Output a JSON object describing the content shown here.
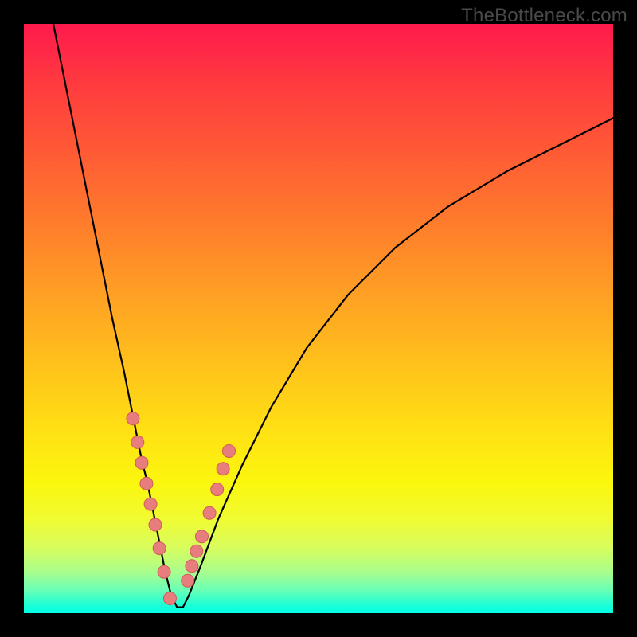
{
  "watermark": {
    "text": "TheBottleneck.com"
  },
  "colors": {
    "frame_bg": "#000000",
    "curve_stroke": "#000000",
    "marker_fill": "#e77d7d",
    "marker_stroke": "#d05a5a"
  },
  "chart_data": {
    "type": "line",
    "title": "",
    "xlabel": "",
    "ylabel": "",
    "xlim": [
      0,
      100
    ],
    "ylim": [
      0,
      100
    ],
    "grid": false,
    "legend": false,
    "series": [
      {
        "name": "bottleneck-curve",
        "x": [
          5,
          7,
          9,
          11,
          13,
          15,
          17,
          19,
          20,
          21,
          22,
          23,
          24,
          25,
          26,
          27,
          28,
          30,
          33,
          37,
          42,
          48,
          55,
          63,
          72,
          82,
          92,
          100
        ],
        "y": [
          100,
          90,
          80,
          70,
          60,
          50,
          41,
          31,
          26,
          22,
          17,
          12,
          7,
          3,
          1,
          1,
          3,
          8,
          16,
          25,
          35,
          45,
          54,
          62,
          69,
          75,
          80,
          84
        ]
      }
    ],
    "markers": [
      {
        "name": "left-cluster",
        "x": [
          18.5,
          19.3,
          20.0,
          20.8,
          21.5,
          22.3,
          23.0,
          23.8,
          24.8
        ],
        "y": [
          33.0,
          29.0,
          25.5,
          22.0,
          18.5,
          15.0,
          11.0,
          7.0,
          2.5
        ]
      },
      {
        "name": "right-cluster",
        "x": [
          27.8,
          28.5,
          29.3,
          30.2,
          31.5,
          32.8,
          33.8,
          34.8
        ],
        "y": [
          5.5,
          8.0,
          10.5,
          13.0,
          17.0,
          21.0,
          24.5,
          27.5
        ]
      }
    ]
  }
}
